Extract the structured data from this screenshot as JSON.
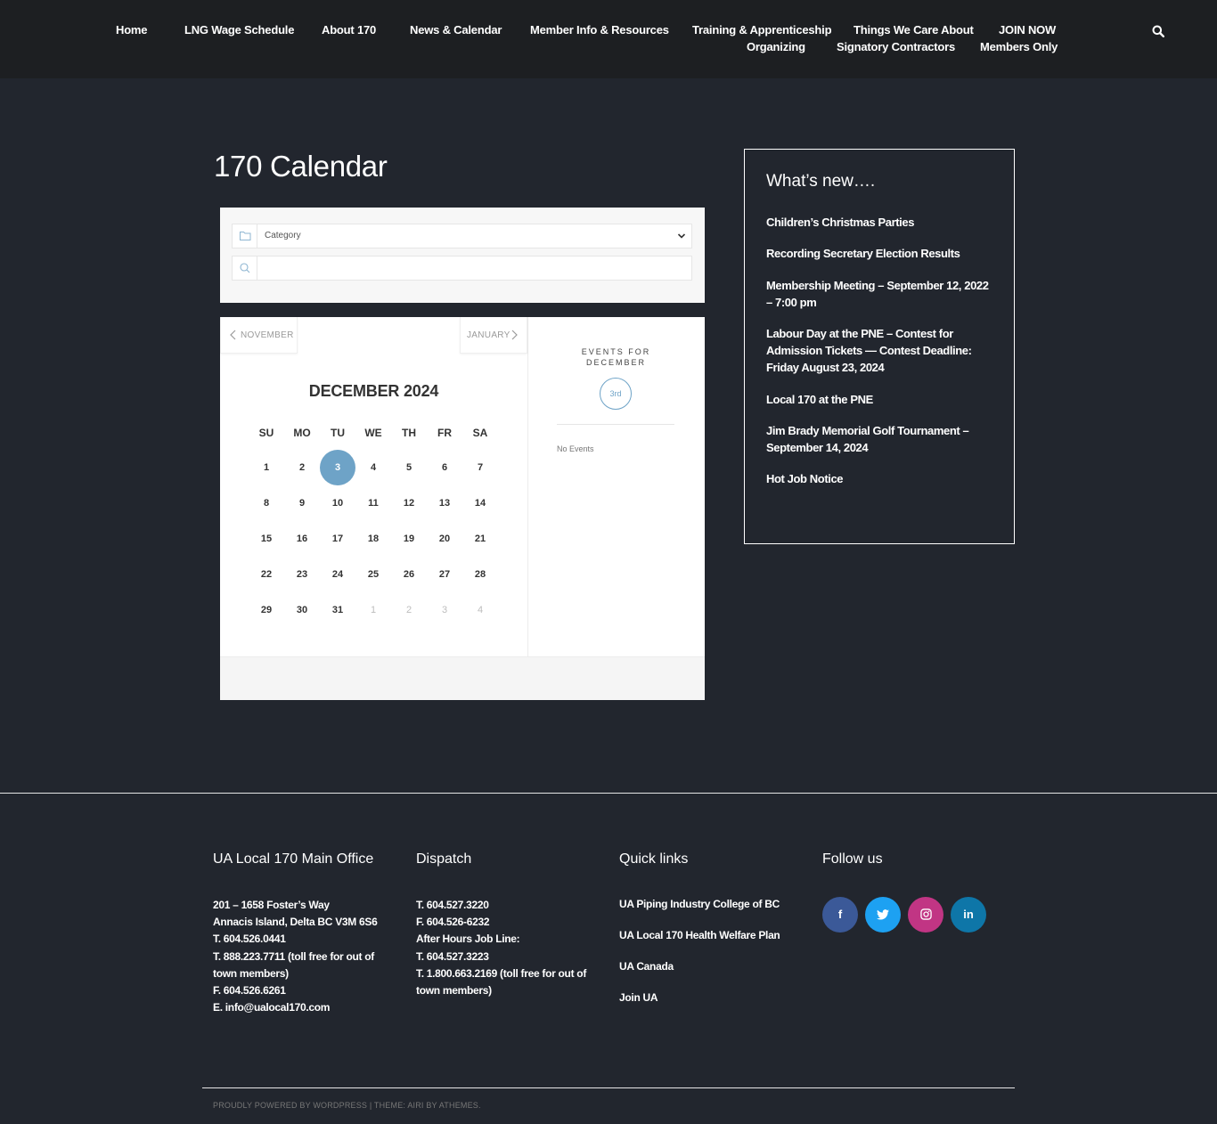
{
  "nav": {
    "home": "Home",
    "lng": "LNG Wage Schedule",
    "about": "About 170",
    "news": "News & Calendar",
    "member": "Member Info & Resources",
    "training": "Training & Apprenticeship",
    "organizing": "Organizing",
    "things": "Things We Care About",
    "signatory": "Signatory Contractors",
    "join": "JOIN NOW",
    "members_only": "Members Only"
  },
  "page": {
    "title": "170 Calendar"
  },
  "filters": {
    "category_placeholder": "Category",
    "search_value": ""
  },
  "calendar": {
    "prev_label": "NOVEMBER",
    "next_label": "JANUARY",
    "month_title": "DECEMBER 2024",
    "weekdays": [
      "SU",
      "MO",
      "TU",
      "WE",
      "TH",
      "FR",
      "SA"
    ],
    "weeks": [
      [
        "1",
        "2",
        "3",
        "4",
        "5",
        "6",
        "7"
      ],
      [
        "8",
        "9",
        "10",
        "11",
        "12",
        "13",
        "14"
      ],
      [
        "15",
        "16",
        "17",
        "18",
        "19",
        "20",
        "21"
      ],
      [
        "22",
        "23",
        "24",
        "25",
        "26",
        "27",
        "28"
      ],
      [
        "29",
        "30",
        "31",
        "1",
        "2",
        "3",
        "4"
      ]
    ],
    "selected_day": "3",
    "events_header_1": "EVENTS FOR",
    "events_header_2": "DECEMBER",
    "selected_badge": "3rd",
    "no_events": "No Events"
  },
  "sidebar": {
    "title": "What’s new….",
    "links": [
      "Children’s Christmas Parties",
      "Recording Secretary Election Results",
      "Membership Meeting – September 12, 2022 – 7:00 pm",
      "Labour Day at the PNE – Contest for Admission Tickets — Contest Deadline: Friday August 23, 2024",
      "Local 170 at the PNE",
      "Jim Brady Memorial Golf Tournament – September 14, 2024",
      "Hot Job Notice"
    ]
  },
  "footer": {
    "office_title": "UA Local 170 Main Office",
    "office_lines": [
      "201 – 1658 Foster’s Way",
      "Annacis Island, Delta BC V3M 6S6",
      "T. 604.526.0441",
      "T. 888.223.7711 (toll free for out of town members)",
      "F. 604.526.6261",
      "E. info@ualocal170.com"
    ],
    "dispatch_title": "Dispatch",
    "dispatch_lines": [
      "T. 604.527.3220",
      "F. 604.526-6232",
      "After Hours Job Line:",
      "T. 604.527.3223",
      "T. 1.800.663.2169 (toll free for out of town members)"
    ],
    "quick_title": "Quick links",
    "quick_links": [
      "UA Piping Industry College of BC",
      "UA Local 170 Health Welfare Plan",
      "UA Canada",
      "Join UA"
    ],
    "follow_title": "Follow us",
    "social": [
      {
        "glyph": "f",
        "color": "#3b5998"
      },
      {
        "glyph": "t",
        "color": "#1da1f2"
      },
      {
        "glyph": "ig",
        "color": "#c13584"
      },
      {
        "glyph": "in",
        "color": "#0e76a8"
      }
    ],
    "credits": "PROUDLY POWERED BY WORDPRESS | THEME: AIRI BY ATHEMES."
  },
  "colors": {
    "accent": "#6ea3c7",
    "background": "#22262e",
    "header": "#1d1f22"
  }
}
